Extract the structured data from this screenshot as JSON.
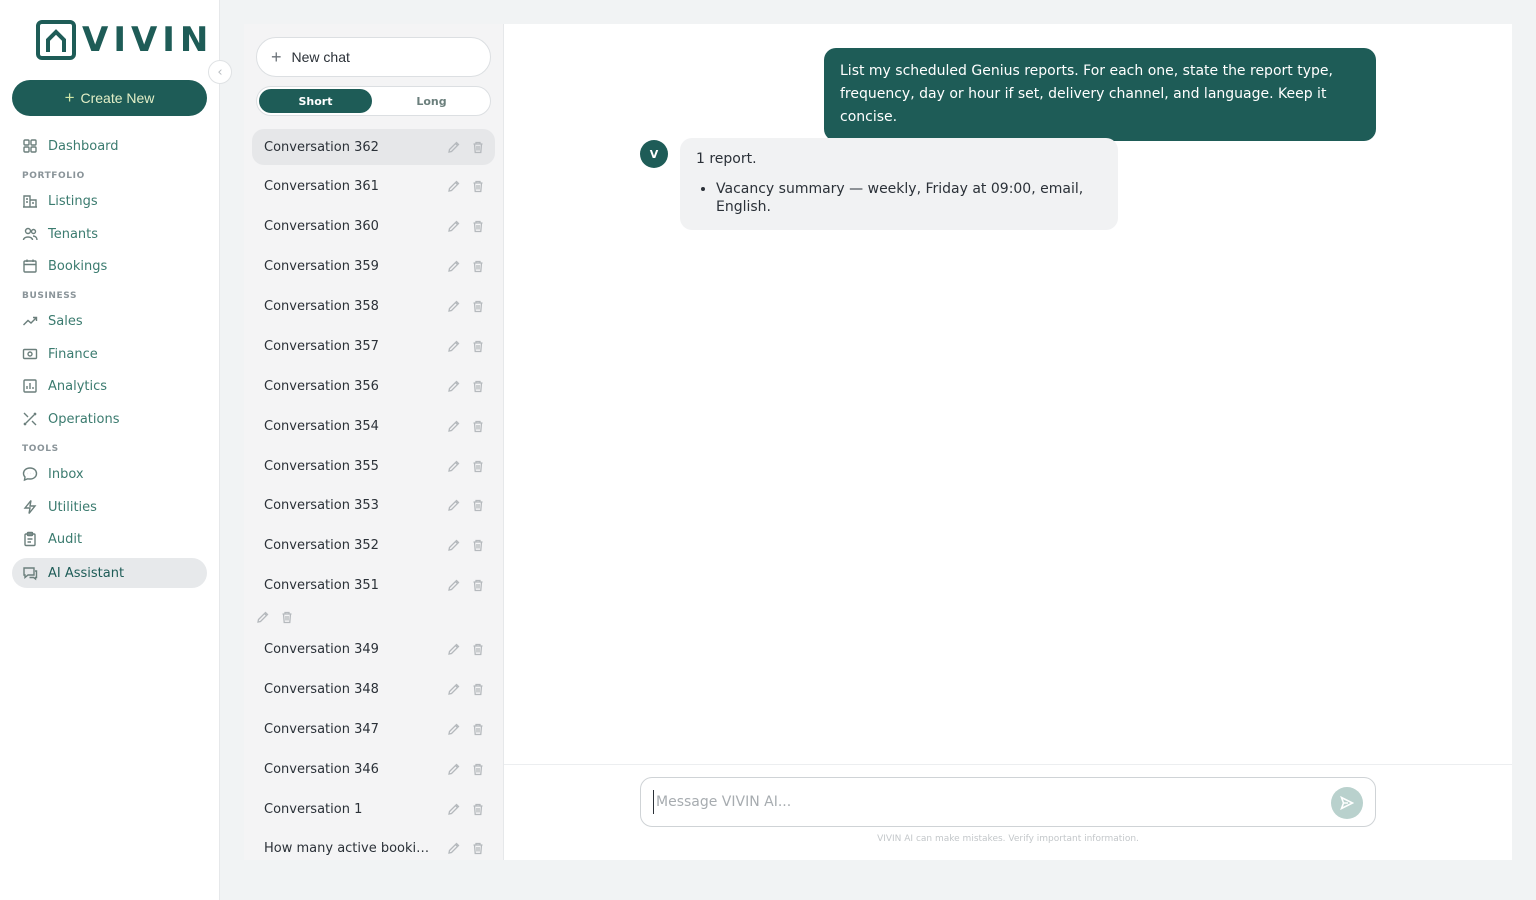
{
  "brand": {
    "name": "VIVIN"
  },
  "sidebar": {
    "create_label": "Create New",
    "sections": {
      "portfolio": "PORTFOLIO",
      "business": "BUSINESS",
      "tools": "TOOLS"
    },
    "items": [
      {
        "label": "Dashboard",
        "icon": "grid-icon"
      },
      {
        "label": "Listings",
        "icon": "building-icon"
      },
      {
        "label": "Tenants",
        "icon": "users-icon"
      },
      {
        "label": "Bookings",
        "icon": "calendar-icon"
      },
      {
        "label": "Sales",
        "icon": "trend-icon"
      },
      {
        "label": "Finance",
        "icon": "money-icon"
      },
      {
        "label": "Analytics",
        "icon": "bar-chart-icon"
      },
      {
        "label": "Operations",
        "icon": "tools-icon"
      },
      {
        "label": "Inbox",
        "icon": "chat-bubble-icon"
      },
      {
        "label": "Utilities",
        "icon": "bolt-icon"
      },
      {
        "label": "Audit",
        "icon": "clipboard-icon"
      },
      {
        "label": "AI Assistant",
        "icon": "ai-chat-icon",
        "active": true
      }
    ]
  },
  "conversations": {
    "new_chat_label": "New chat",
    "toggle": {
      "short": "Short",
      "long": "Long",
      "selected": "Short"
    },
    "items": [
      "Conversation 362",
      "Conversation 361",
      "Conversation 360",
      "Conversation 359",
      "Conversation 358",
      "Conversation 357",
      "Conversation 356",
      "Conversation 354",
      "Conversation 355",
      "Conversation 353",
      "Conversation 352",
      "Conversation 351",
      "",
      "Conversation 349",
      "Conversation 348",
      "Conversation 347",
      "Conversation 346",
      "Conversation 1",
      "How many active booking..."
    ],
    "selected_index": 0
  },
  "chat": {
    "user_message": "List my scheduled Genius reports. For each one, state the report type, frequency, day or hour if set, delivery channel, and language. Keep it concise.",
    "assistant_avatar": "V",
    "assistant_intro": "1 report.",
    "assistant_bullets": [
      "Vacancy summary — weekly, Friday at 09:00, email, English."
    ],
    "input_placeholder": "Message VIVIN AI...",
    "disclaimer": "VIVIN AI can make mistakes. Verify important information."
  },
  "colors": {
    "brand": "#1e5c57",
    "accent_text": "#e3efc7"
  }
}
